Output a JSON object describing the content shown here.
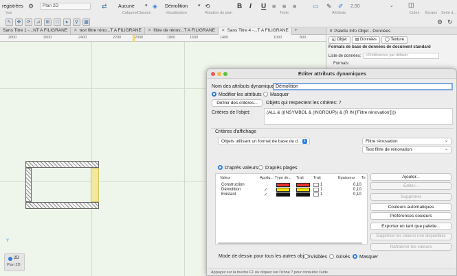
{
  "toolbar": {
    "registrees": "registrées",
    "vue": "Vue",
    "plan_2d": "Plan 2D",
    "aucune": "Aucune",
    "calques_classes": "Calques/Classes",
    "demolition_class": "Démolition",
    "visualisation": "Visualisation",
    "rotation_plan": "Rotation du plan",
    "texte": "Texte",
    "attributs": "Attributs",
    "cotes_value": "2,50",
    "ecrans": "Écrans",
    "serie": "Serie d...",
    "cotes": "Cotes",
    "bold": "B",
    "italic": "I",
    "underline": "U"
  },
  "tabs": [
    {
      "label": "Sans Titre 1 -...NT A FILIGRANE",
      "active": false
    },
    {
      "label": "test filtre réno...T A FILIGRANE",
      "active": false
    },
    {
      "label": "filtre de rénov...T A FILIGRANE",
      "active": false
    },
    {
      "label": "Sans Titre 4 -...T A FILIGRANE",
      "active": true
    }
  ],
  "tab_add": "+",
  "ruler": [
    "2800",
    "2600",
    "2400",
    "2200",
    "2000",
    "1800",
    "1600",
    "1400",
    "1000",
    "800"
  ],
  "view_panel": {
    "mode": "2D",
    "name": "Plan 2D"
  },
  "palette": {
    "title": "Palette Info Objet - Données",
    "tabs": [
      "Objet",
      "Données",
      "Texture"
    ],
    "active_tab": "Données",
    "section": "Formats de base de données de document standard",
    "list_label": "Liste de données:",
    "list_placeholder": "<Préférences par défaut>",
    "formats_label": "Formats:"
  },
  "dialog": {
    "title": "Éditer attributs dynamiques",
    "name_label": "Nom des attributs dynamiques:",
    "name_value": "Démolition",
    "radio_modify": "Modifier les attributs",
    "radio_mask": "Masquer",
    "define_button": "Définir des critères...",
    "objects_count": "Objets qui respectent les critères: 7",
    "criteria_label": "Critères de l'objet:",
    "criteria_value": "(ALL & ((INSYMBOL & (INGROUP)) & (R IN ['Filtre rénovation'])))",
    "display_criteria": "Critères d'affichage",
    "format_select": "Objets utilisant un format de base de d...",
    "filter_select": "Filtre rénovation",
    "filter_field_select": "Test filtre de rénovation",
    "radio_values": "D'après valeurs",
    "radio_ranges": "D'après plages",
    "table_headers": [
      "Valeur",
      "Appliq...",
      "Type de...",
      "Trait",
      "Trait",
      "Épaisseur",
      "Te"
    ],
    "rows": [
      {
        "value": "Construction",
        "applied": "",
        "fill": "#e53232",
        "stroke": "#e53232",
        "weight": "1",
        "thickness": "0,10"
      },
      {
        "value": "Démolition",
        "applied": "✓",
        "fill": "#f0e000",
        "stroke": "#f0e000",
        "weight": "1",
        "thickness": "0,10"
      },
      {
        "value": "Existant",
        "applied": "✓",
        "fill": "#111111",
        "stroke": "#111111",
        "weight": "1",
        "thickness": "0,10"
      }
    ],
    "buttons": [
      {
        "label": "Ajouter...",
        "disabled": false
      },
      {
        "label": "Éditer...",
        "disabled": true
      },
      {
        "label": "Supprimer",
        "disabled": true
      },
      {
        "label": "Couleurs automatiques",
        "disabled": false
      },
      {
        "label": "Préférences couleurs",
        "disabled": false
      },
      {
        "label": "Exporter en tant que palette...",
        "disabled": false
      },
      {
        "label": "Supprimer les valeurs non disponibles",
        "disabled": true
      },
      {
        "label": "Rafraîchir les valeurs",
        "disabled": true
      }
    ],
    "draw_mode_label": "Mode de dessin pour tous les autres objets:",
    "draw_modes": [
      "Visibles",
      "Grisés",
      "Masquer"
    ],
    "draw_mode_selected": "Masquer",
    "status": "Appuyez sur la touche F1 ou cliquez sur l'icône ? pour consulter l'aide."
  },
  "colors": {
    "accent": "#2f7ce0",
    "canvas": "#eef5ea",
    "construction": "#e53232",
    "demolition": "#f0e000",
    "existant": "#111111"
  }
}
